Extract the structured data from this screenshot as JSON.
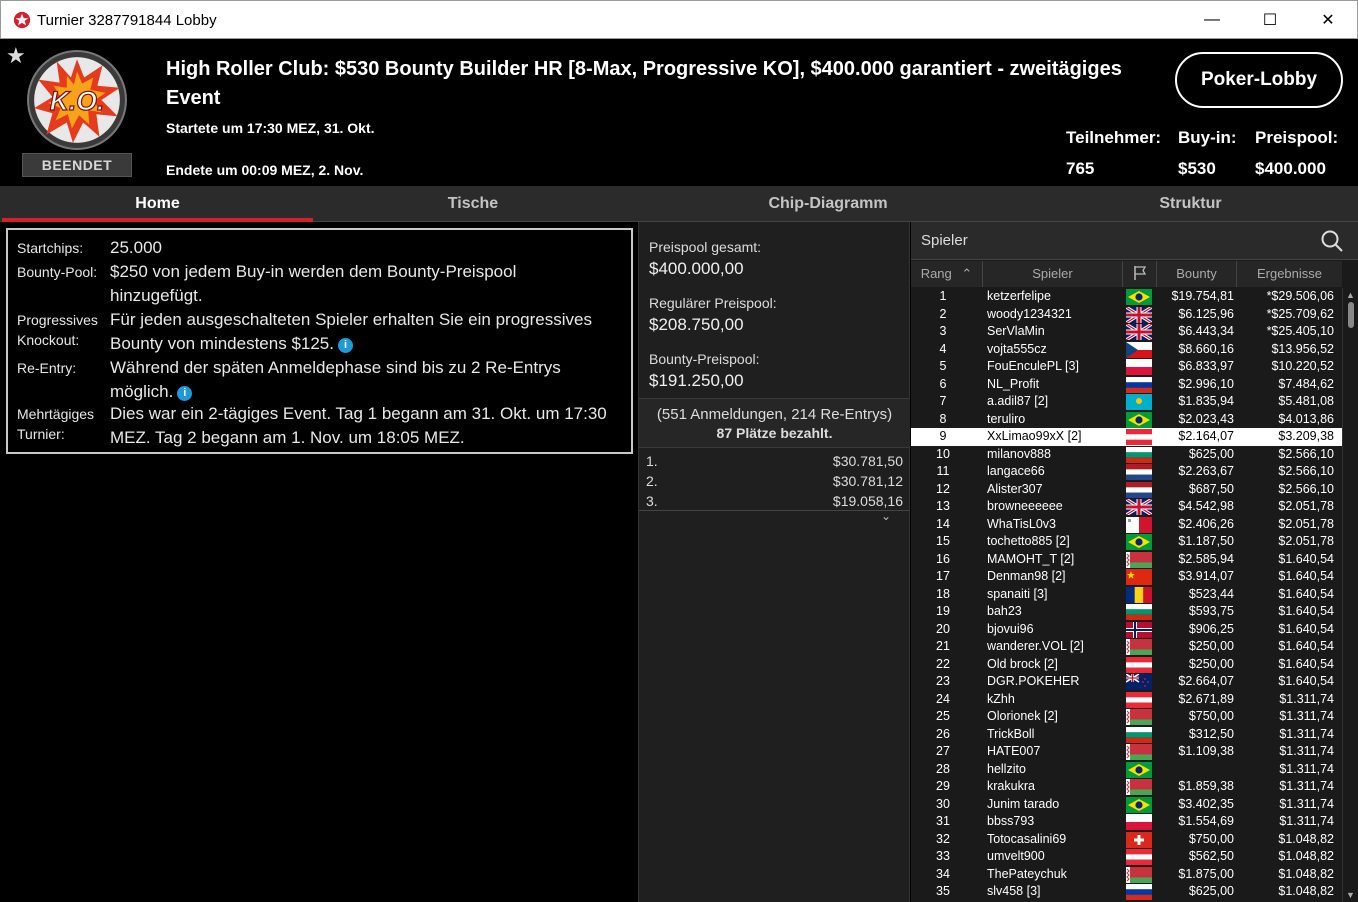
{
  "window": {
    "title": "Turnier 3287791844 Lobby",
    "min_glyph": "—",
    "max_glyph": "☐",
    "close_glyph": "✕"
  },
  "header": {
    "status": "BEENDET",
    "logo_text": "K.O.",
    "title": "High Roller Club: $530 Bounty Builder HR [8-Max, Progressive KO], $400.000 garantiert - zweitägiges Event",
    "started": "Startete um 17:30 MEZ, 31. Okt.",
    "ended": "Endete um 00:09 MEZ, 2. Nov.",
    "lobby_button": "Poker-Lobby",
    "stats": [
      {
        "label": "Teilnehmer:",
        "value": "765"
      },
      {
        "label": "Buy-in:",
        "value": "$530"
      },
      {
        "label": "Preispool:",
        "value": "$400.000"
      }
    ]
  },
  "tabs": [
    "Home",
    "Tische",
    "Chip-Diagramm",
    "Struktur"
  ],
  "info": {
    "startchips_label": "Startchips:",
    "startchips": "25.000",
    "bounty_label": "Bounty-Pool:",
    "bounty_text_1": "$250 von jedem Buy-in werden dem Bounty-Preispool",
    "bounty_text_2": "hinzugefügt.",
    "pko_label_1": "Progressives",
    "pko_label_2": "Knockout:",
    "pko_text_1": "Für jeden ausgeschalteten Spieler erhalten Sie ein progressives",
    "pko_text_2": "Bounty von mindestens $125.",
    "reentry_label": "Re-Entry:",
    "reentry_text_1": "Während der späten Anmeldephase sind bis zu 2 Re-Entrys",
    "reentry_text_2": "möglich.",
    "multiday_label_1": "Mehrtägiges",
    "multiday_label_2": "Turnier:",
    "multiday_text_1": "Dies war ein 2-tägiges Event. Tag 1 begann am 31. Okt. um 17:30",
    "multiday_text_2": "MEZ. Tag 2 begann am 1. Nov. um 18:05 MEZ."
  },
  "prize": {
    "total_label": "Preispool gesamt:",
    "total": "$400.000,00",
    "regular_label": "Regulärer Preispool:",
    "regular": "$208.750,00",
    "bounty_label": "Bounty-Preispool:",
    "bounty": "$191.250,00",
    "registrations": "(551 Anmeldungen, 214 Re-Entrys)",
    "paid": "87 Plätze bezahlt.",
    "payouts": [
      {
        "rank": "1.",
        "amount": "$30.781,50"
      },
      {
        "rank": "2.",
        "amount": "$30.781,12"
      },
      {
        "rank": "3.",
        "amount": "$19.058,16"
      }
    ]
  },
  "players": {
    "search_label": "Spieler",
    "columns": [
      "Rang",
      "Spieler",
      "Bounty",
      "Ergebnisse"
    ],
    "selected_index": 8,
    "rows": [
      {
        "rank": "1",
        "name": "ketzerfelipe",
        "flag": "br",
        "bounty": "$19.754,81",
        "result": "*$29.506,06"
      },
      {
        "rank": "2",
        "name": "woody1234321",
        "flag": "gb",
        "bounty": "$6.125,96",
        "result": "*$25.709,62"
      },
      {
        "rank": "3",
        "name": "SerVlaMin",
        "flag": "gb",
        "bounty": "$6.443,34",
        "result": "*$25.405,10"
      },
      {
        "rank": "4",
        "name": "vojta555cz",
        "flag": "cz",
        "bounty": "$8.660,16",
        "result": "$13.956,52"
      },
      {
        "rank": "5",
        "name": "FouEnculePL [3]",
        "flag": "pl",
        "bounty": "$6.833,97",
        "result": "$10.220,52"
      },
      {
        "rank": "6",
        "name": "NL_Profit",
        "flag": "ru",
        "bounty": "$2.996,10",
        "result": "$7.484,62"
      },
      {
        "rank": "7",
        "name": "a.adil87 [2]",
        "flag": "kz",
        "bounty": "$1.835,94",
        "result": "$5.481,08"
      },
      {
        "rank": "8",
        "name": "teruliro",
        "flag": "br",
        "bounty": "$2.023,43",
        "result": "$4.013,86"
      },
      {
        "rank": "9",
        "name": "XxLimao99xX [2]",
        "flag": "at",
        "bounty": "$2.164,07",
        "result": "$3.209,38"
      },
      {
        "rank": "10",
        "name": "milanov888",
        "flag": "bg",
        "bounty": "$625,00",
        "result": "$2.566,10"
      },
      {
        "rank": "11",
        "name": "langace66",
        "flag": "nl",
        "bounty": "$2.263,67",
        "result": "$2.566,10"
      },
      {
        "rank": "12",
        "name": "Alister307",
        "flag": "nl",
        "bounty": "$687,50",
        "result": "$2.566,10"
      },
      {
        "rank": "13",
        "name": "browneeeeee",
        "flag": "gb",
        "bounty": "$4.542,98",
        "result": "$2.051,78"
      },
      {
        "rank": "14",
        "name": "WhaTisL0v3",
        "flag": "mt",
        "bounty": "$2.406,26",
        "result": "$2.051,78"
      },
      {
        "rank": "15",
        "name": "tochetto885 [2]",
        "flag": "br",
        "bounty": "$1.187,50",
        "result": "$2.051,78"
      },
      {
        "rank": "16",
        "name": "MAMOHT_T [2]",
        "flag": "by",
        "bounty": "$2.585,94",
        "result": "$1.640,54"
      },
      {
        "rank": "17",
        "name": "Denman98 [2]",
        "flag": "cn",
        "bounty": "$3.914,07",
        "result": "$1.640,54"
      },
      {
        "rank": "18",
        "name": "spanaiti [3]",
        "flag": "ro",
        "bounty": "$523,44",
        "result": "$1.640,54"
      },
      {
        "rank": "19",
        "name": "bah23",
        "flag": "bg",
        "bounty": "$593,75",
        "result": "$1.640,54"
      },
      {
        "rank": "20",
        "name": "bjovui96",
        "flag": "no",
        "bounty": "$906,25",
        "result": "$1.640,54"
      },
      {
        "rank": "21",
        "name": "wanderer.VOL [2]",
        "flag": "by",
        "bounty": "$250,00",
        "result": "$1.640,54"
      },
      {
        "rank": "22",
        "name": "Old brock [2]",
        "flag": "at",
        "bounty": "$250,00",
        "result": "$1.640,54"
      },
      {
        "rank": "23",
        "name": "DGR.POKEHER",
        "flag": "nz",
        "bounty": "$2.664,07",
        "result": "$1.640,54"
      },
      {
        "rank": "24",
        "name": "kZhh",
        "flag": "at",
        "bounty": "$2.671,89",
        "result": "$1.311,74"
      },
      {
        "rank": "25",
        "name": "Olorionek [2]",
        "flag": "by",
        "bounty": "$750,00",
        "result": "$1.311,74"
      },
      {
        "rank": "26",
        "name": "TrickBoll",
        "flag": "bg",
        "bounty": "$312,50",
        "result": "$1.311,74"
      },
      {
        "rank": "27",
        "name": "HATE007",
        "flag": "by",
        "bounty": "$1.109,38",
        "result": "$1.311,74"
      },
      {
        "rank": "28",
        "name": "hellzito",
        "flag": "br",
        "bounty": "",
        "result": "$1.311,74"
      },
      {
        "rank": "29",
        "name": "krakukra",
        "flag": "by",
        "bounty": "$1.859,38",
        "result": "$1.311,74"
      },
      {
        "rank": "30",
        "name": "Junim tarado",
        "flag": "br",
        "bounty": "$3.402,35",
        "result": "$1.311,74"
      },
      {
        "rank": "31",
        "name": "bbss793",
        "flag": "pl",
        "bounty": "$1.554,69",
        "result": "$1.311,74"
      },
      {
        "rank": "32",
        "name": "Totocasalini69",
        "flag": "ch",
        "bounty": "$750,00",
        "result": "$1.048,82"
      },
      {
        "rank": "33",
        "name": "umvelt900",
        "flag": "at",
        "bounty": "$562,50",
        "result": "$1.048,82"
      },
      {
        "rank": "34",
        "name": "ThePateychuk",
        "flag": "by",
        "bounty": "$1.875,00",
        "result": "$1.048,82"
      },
      {
        "rank": "35",
        "name": "slv458 [3]",
        "flag": "ru",
        "bounty": "$625,00",
        "result": "$1.048,82"
      }
    ]
  },
  "colors": {
    "accent_red": "#d31f2e",
    "info_blue": "#1e9ad6"
  }
}
